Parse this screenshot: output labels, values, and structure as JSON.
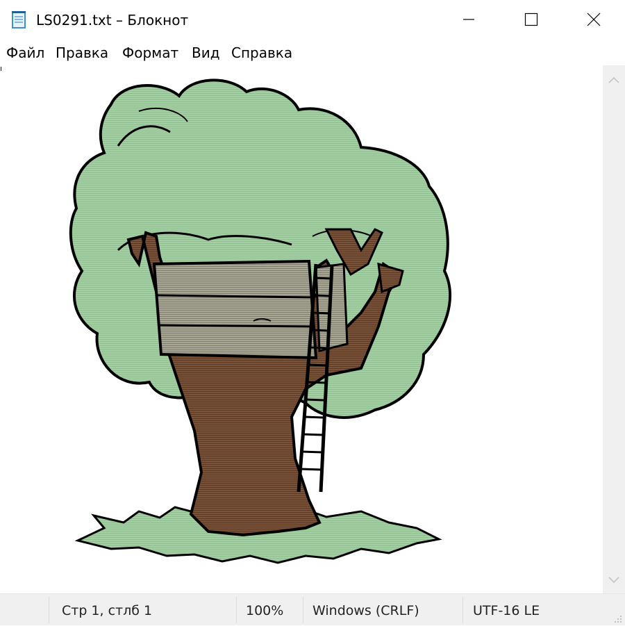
{
  "window": {
    "title": "LS0291.txt – Блокнот",
    "controls": [
      "minimize",
      "maximize",
      "close"
    ]
  },
  "menu": {
    "items": [
      "Файл",
      "Правка",
      "Формат",
      "Вид",
      "Справка"
    ]
  },
  "editor": {
    "content_description": "ASCII-style striped art of a treehouse"
  },
  "status": {
    "position": "Стр 1, стлб 1",
    "zoom": "100%",
    "line_endings": "Windows (CRLF)",
    "encoding": "UTF-16 LE"
  },
  "colors": {
    "foliage": "#a4cfa4",
    "trunk": "#7a5238",
    "wood": "#9c9a8c",
    "outline": "#000000",
    "statusbar": "#f0f0f0"
  },
  "icons": [
    "notepad-icon",
    "minimize-icon",
    "maximize-icon",
    "close-icon",
    "scroll-up-arrow-icon",
    "scroll-down-arrow-icon",
    "resize-grip-icon"
  ]
}
